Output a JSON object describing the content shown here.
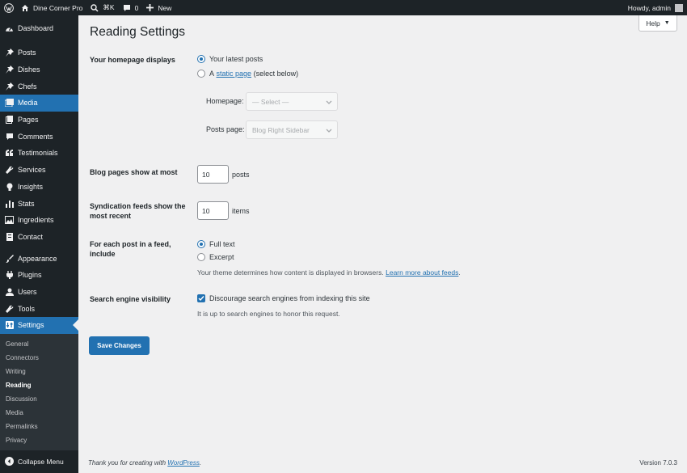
{
  "adminbar": {
    "site_name": "Dine Corner Pro",
    "search_shortcut": "⌘K",
    "comments_count": "0",
    "new_label": "New",
    "greeting": "Howdy, admin"
  },
  "sidebar": {
    "dashboard": "Dashboard",
    "posts": "Posts",
    "dishes": "Dishes",
    "chefs": "Chefs",
    "media": "Media",
    "pages": "Pages",
    "comments": "Comments",
    "testimonials": "Testimonials",
    "services": "Services",
    "insights": "Insights",
    "stats": "Stats",
    "ingredients": "Ingredients",
    "contact": "Contact",
    "appearance": "Appearance",
    "plugins": "Plugins",
    "users": "Users",
    "tools": "Tools",
    "settings": "Settings",
    "submenu": [
      "General",
      "Connectors",
      "Writing",
      "Reading",
      "Discussion",
      "Media",
      "Permalinks",
      "Privacy"
    ],
    "collapse": "Collapse Menu"
  },
  "help_label": "Help",
  "page_title": "Reading Settings",
  "homepage": {
    "label": "Your homepage displays",
    "opt_latest": "Your latest posts",
    "opt_static_prefix": "A",
    "opt_static_link": "static page",
    "opt_static_suffix": "(select below)",
    "selected": "latest",
    "homepage_label": "Homepage:",
    "homepage_value": "— Select —",
    "posts_page_label": "Posts page:",
    "posts_page_value": "Blog Right Sidebar"
  },
  "blog_pages": {
    "label": "Blog pages show at most",
    "value": "10",
    "unit": "posts"
  },
  "syndication": {
    "label": "Syndication feeds show the most recent",
    "value": "10",
    "unit": "items"
  },
  "feed_content": {
    "label": "For each post in a feed, include",
    "opt_full": "Full text",
    "opt_excerpt": "Excerpt",
    "selected": "full",
    "desc_text": "Your theme determines how content is displayed in browsers.",
    "desc_link": "Learn more about feeds"
  },
  "visibility": {
    "label": "Search engine visibility",
    "checkbox_label": "Discourage search engines from indexing this site",
    "checked": true,
    "desc": "It is up to search engines to honor this request."
  },
  "save_label": "Save Changes",
  "footer": {
    "thanks_prefix": "Thank you for creating with",
    "thanks_link": "WordPress",
    "version": "Version 7.0.3"
  },
  "colors": {
    "accent": "#2271b1",
    "sidebar_bg": "#1d2327",
    "page_bg": "#f0f0f1"
  }
}
